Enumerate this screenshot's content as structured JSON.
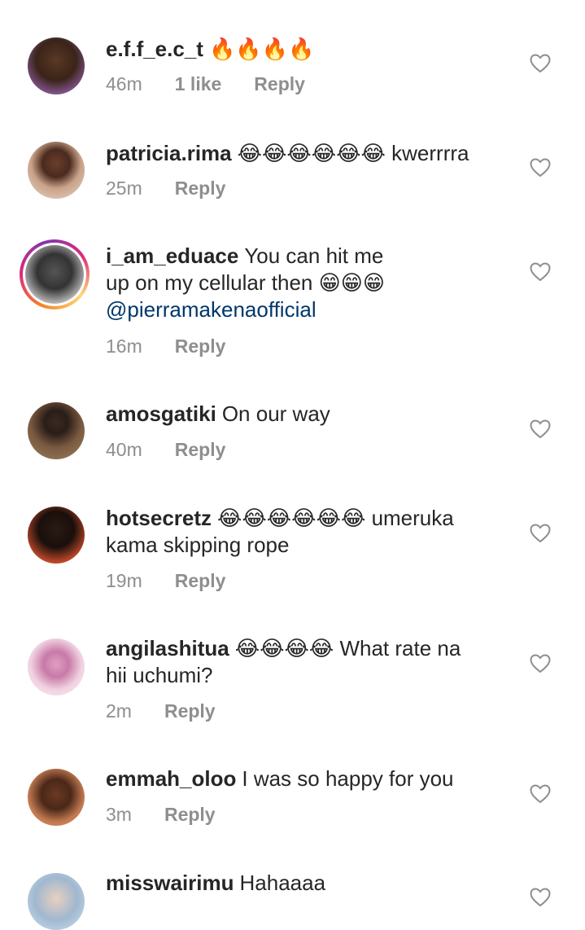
{
  "comments": [
    {
      "username": "e.f.f_e.c_t",
      "text": "",
      "emojis": "🔥🔥🔥🔥",
      "age": "46m",
      "likes": "1 like",
      "reply": "Reply"
    },
    {
      "username": "patricia.rima",
      "text": "kwerrrra",
      "emojis": "😂😂😂😂😂😂",
      "age": "25m",
      "reply": "Reply"
    },
    {
      "username": "i_am_eduace",
      "text_a": "You can hit me",
      "text_b": "up on my cellular then",
      "emojis": "😁😁😁",
      "mention": "@pierramakenaofficial",
      "age": "16m",
      "reply": "Reply"
    },
    {
      "username": "amosgatiki",
      "text": "On our way",
      "age": "40m",
      "reply": "Reply"
    },
    {
      "username": "hotsecretz",
      "emojis": "😂😂😂😂😂😂",
      "text_a": "umeruka",
      "text_b": "kama skipping rope",
      "age": "19m",
      "reply": "Reply"
    },
    {
      "username": "angilashitua",
      "emojis": "😂😂😂😂",
      "text_a": "What rate na",
      "text_b": "hii uchumi?",
      "age": "2m",
      "reply": "Reply"
    },
    {
      "username": "emmah_oloo",
      "text": "I was so happy for you",
      "age": "3m",
      "reply": "Reply"
    },
    {
      "username": "misswairimu",
      "text": "Hahaaaa"
    }
  ],
  "colors": {
    "text": "#262626",
    "meta": "#8e8e8e",
    "mention": "#00376b"
  }
}
